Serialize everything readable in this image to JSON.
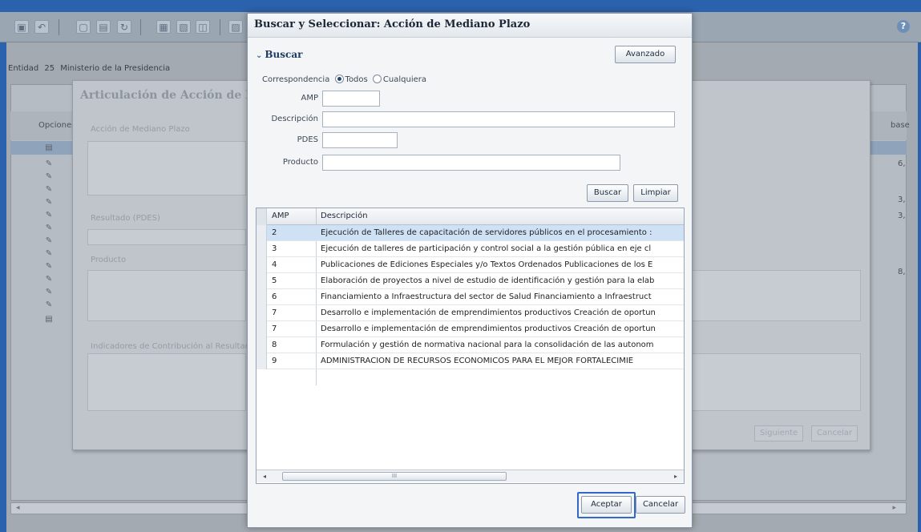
{
  "app": {
    "entity_label": "Entidad",
    "entity_number": "25",
    "entity_name": "Ministerio de la Presidencia",
    "column_options": "Opciones",
    "column_base": "base",
    "row_values": [
      "6,",
      "3,",
      "3,",
      "8,"
    ],
    "scroll_left_arrow": "◂",
    "scroll_right_arrow": "▸"
  },
  "toolbar": {
    "icons": [
      "screen-icon",
      "undo-icon",
      "new-document-icon",
      "save-icon",
      "refresh-icon",
      "print-icon",
      "export-pdf-icon",
      "preview-icon",
      "image-icon",
      "help-icon"
    ],
    "help_glyph": "?"
  },
  "wizard": {
    "title": "Articulación de Acción de Mediano Plazo",
    "label_accion": "Acción de Mediano Plazo",
    "label_resultado": "Resultado (PDES)",
    "label_producto": "Producto",
    "label_indicadores": "Indicadores de Contribución al Resultado",
    "btn_siguiente": "Siguiente",
    "btn_cancelar": "Cancelar"
  },
  "dialog": {
    "title": "Buscar y Seleccionar: Acción de Mediano Plazo",
    "section_label": "Buscar",
    "section_toggle": "⌄",
    "btn_avanzado": "Avanzado",
    "match_label": "Correspondencia",
    "match_all": "Todos",
    "match_any": "Cualquiera",
    "match_selected": "Todos",
    "fields": {
      "amp_label": "AMP",
      "amp_value": "",
      "descripcion_label": "Descripción",
      "descripcion_value": "",
      "pdes_label": "PDES",
      "pdes_value": "",
      "producto_label": "Producto",
      "producto_value": ""
    },
    "btn_buscar": "Buscar",
    "btn_limpiar": "Limpiar",
    "table": {
      "headers": [
        "AMP",
        "Descripción"
      ],
      "rows": [
        {
          "amp": "2",
          "desc": "Ejecución de Talleres de capacitación de servidores públicos en el procesamiento :",
          "selected": true
        },
        {
          "amp": "3",
          "desc": "Ejecución de talleres de participación y control social a la gestión pública en eje cl",
          "selected": false
        },
        {
          "amp": "4",
          "desc": "Publicaciones de Ediciones Especiales y/o Textos Ordenados Publicaciones de los E",
          "selected": false
        },
        {
          "amp": "5",
          "desc": "Elaboración de proyectos a nivel de estudio de identificación y gestión para la elab",
          "selected": false
        },
        {
          "amp": "6",
          "desc": "Financiamiento a Infraestructura del sector de Salud Financiamiento a Infraestruct",
          "selected": false
        },
        {
          "amp": "7",
          "desc": "Desarrollo e implementación de emprendimientos productivos Creación de oportun",
          "selected": false
        },
        {
          "amp": "7",
          "desc": "Desarrollo e implementación de emprendimientos productivos Creación de oportun",
          "selected": false
        },
        {
          "amp": "8",
          "desc": "Formulación y gestión de normativa nacional para la consolidación de las autonom",
          "selected": false
        },
        {
          "amp": "9",
          "desc": "ADMINISTRACIÓN DE RECURSOS ECONÓMICOS PARA EL MEJOR FORTALECIMIE",
          "selected": false
        }
      ]
    },
    "hscroll": {
      "left_arrow": "◂",
      "right_arrow": "▸",
      "thumb_grip": "III"
    },
    "btn_aceptar": "Aceptar",
    "btn_cancelar": "Cancelar"
  }
}
